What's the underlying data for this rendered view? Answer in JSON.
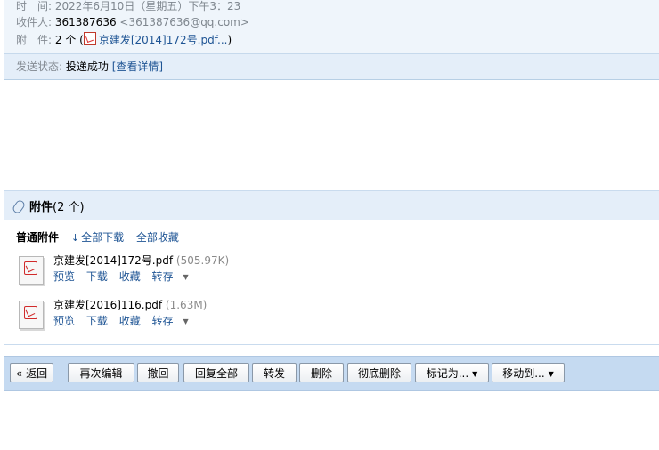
{
  "header": {
    "time_label": "时　间:",
    "time_value": "2022年6月10日（星期五）下午3：23",
    "recipient_label": "收件人:",
    "recipient_name": "361387636",
    "recipient_email": "<361387636@qq.com>",
    "attachment_label": "附　件:",
    "attachment_count": "2 个 (",
    "attachment_link": "京建发[2014]172号.pdf...",
    "attachment_close": ")"
  },
  "status": {
    "label": "发送状态:",
    "value": "投递成功",
    "details_link": "[查看详情]"
  },
  "attachments": {
    "title": "附件",
    "count": "(2 个)",
    "section_label": "普通附件",
    "download_all": "全部下载",
    "save_all": "全部收藏",
    "files": [
      {
        "name": "京建发[2014]172号.pdf",
        "size": "(505.97K)",
        "preview": "预览",
        "download": "下载",
        "favorite": "收藏",
        "save_to": "转存"
      },
      {
        "name": "京建发[2016]116.pdf",
        "size": "(1.63M)",
        "preview": "预览",
        "download": "下载",
        "favorite": "收藏",
        "save_to": "转存"
      }
    ]
  },
  "toolbar": {
    "back": "« 返回",
    "re_edit": "再次编辑",
    "recall": "撤回",
    "reply_all": "回复全部",
    "forward": "转发",
    "delete": "删除",
    "delete_permanent": "彻底删除",
    "mark_as": "标记为...",
    "move_to": "移动到..."
  },
  "colors": {
    "link": "#1e5494",
    "toolbar_bg": "#c5daf1",
    "header_bg": "#eff5fb"
  }
}
